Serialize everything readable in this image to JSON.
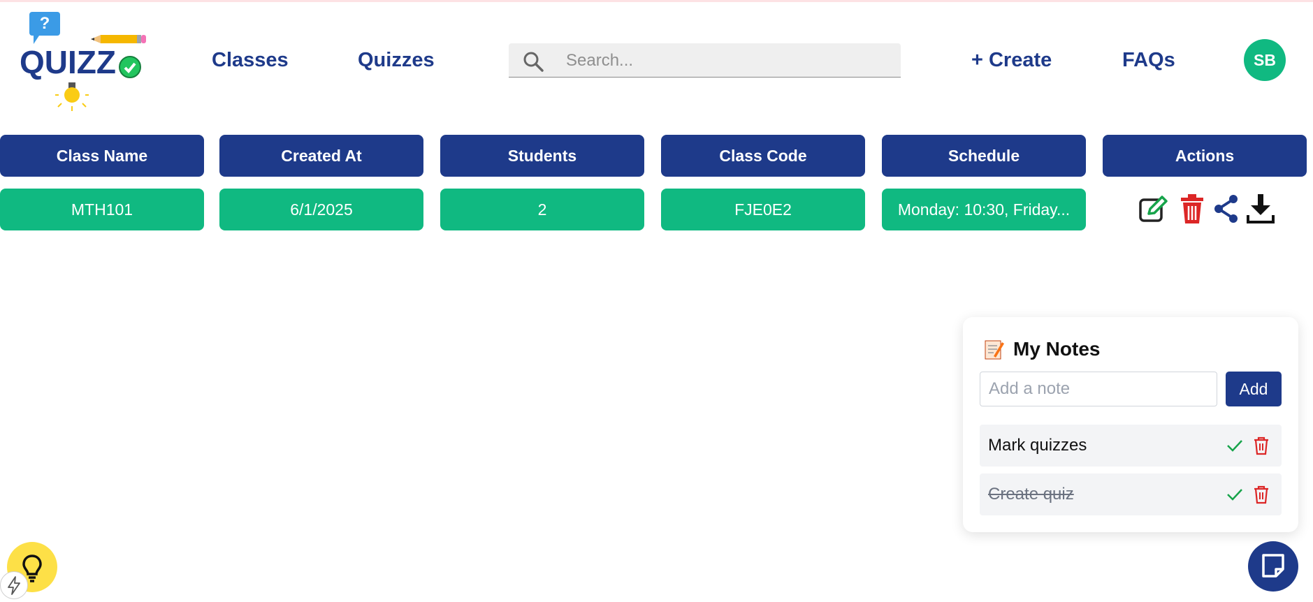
{
  "brand": {
    "logo_text": "QUIZZ",
    "bubble_mark": "?",
    "colors": {
      "primary": "#1e3a8a",
      "accent": "#10b981",
      "danger": "#dc2626",
      "tip": "#fde047"
    }
  },
  "nav": {
    "classes_label": "Classes",
    "quizzes_label": "Quizzes",
    "create_label": "+ Create",
    "faqs_label": "FAQs",
    "avatar_initials": "SB"
  },
  "search": {
    "placeholder": "Search...",
    "value": ""
  },
  "table": {
    "headers": [
      "Class Name",
      "Created At",
      "Students",
      "Class Code",
      "Schedule",
      "Actions"
    ],
    "rows": [
      {
        "class_name": "MTH101",
        "created_at": "6/1/2025",
        "students": "2",
        "class_code": "FJE0E2",
        "schedule": "Monday: 10:30, Friday..."
      }
    ],
    "action_icons": [
      "edit-icon",
      "trash-icon",
      "share-icon",
      "download-icon"
    ]
  },
  "notes": {
    "title": "My Notes",
    "title_icon": "memo-icon",
    "input_placeholder": "Add a note",
    "input_value": "",
    "add_label": "Add",
    "items": [
      {
        "text": "Mark quizzes",
        "done": false
      },
      {
        "text": "Create quiz",
        "done": true
      }
    ]
  },
  "floating": {
    "notes_button_icon": "note-icon",
    "tip_button_icon": "lightbulb-icon",
    "badge_icon": "bolt-icon"
  }
}
